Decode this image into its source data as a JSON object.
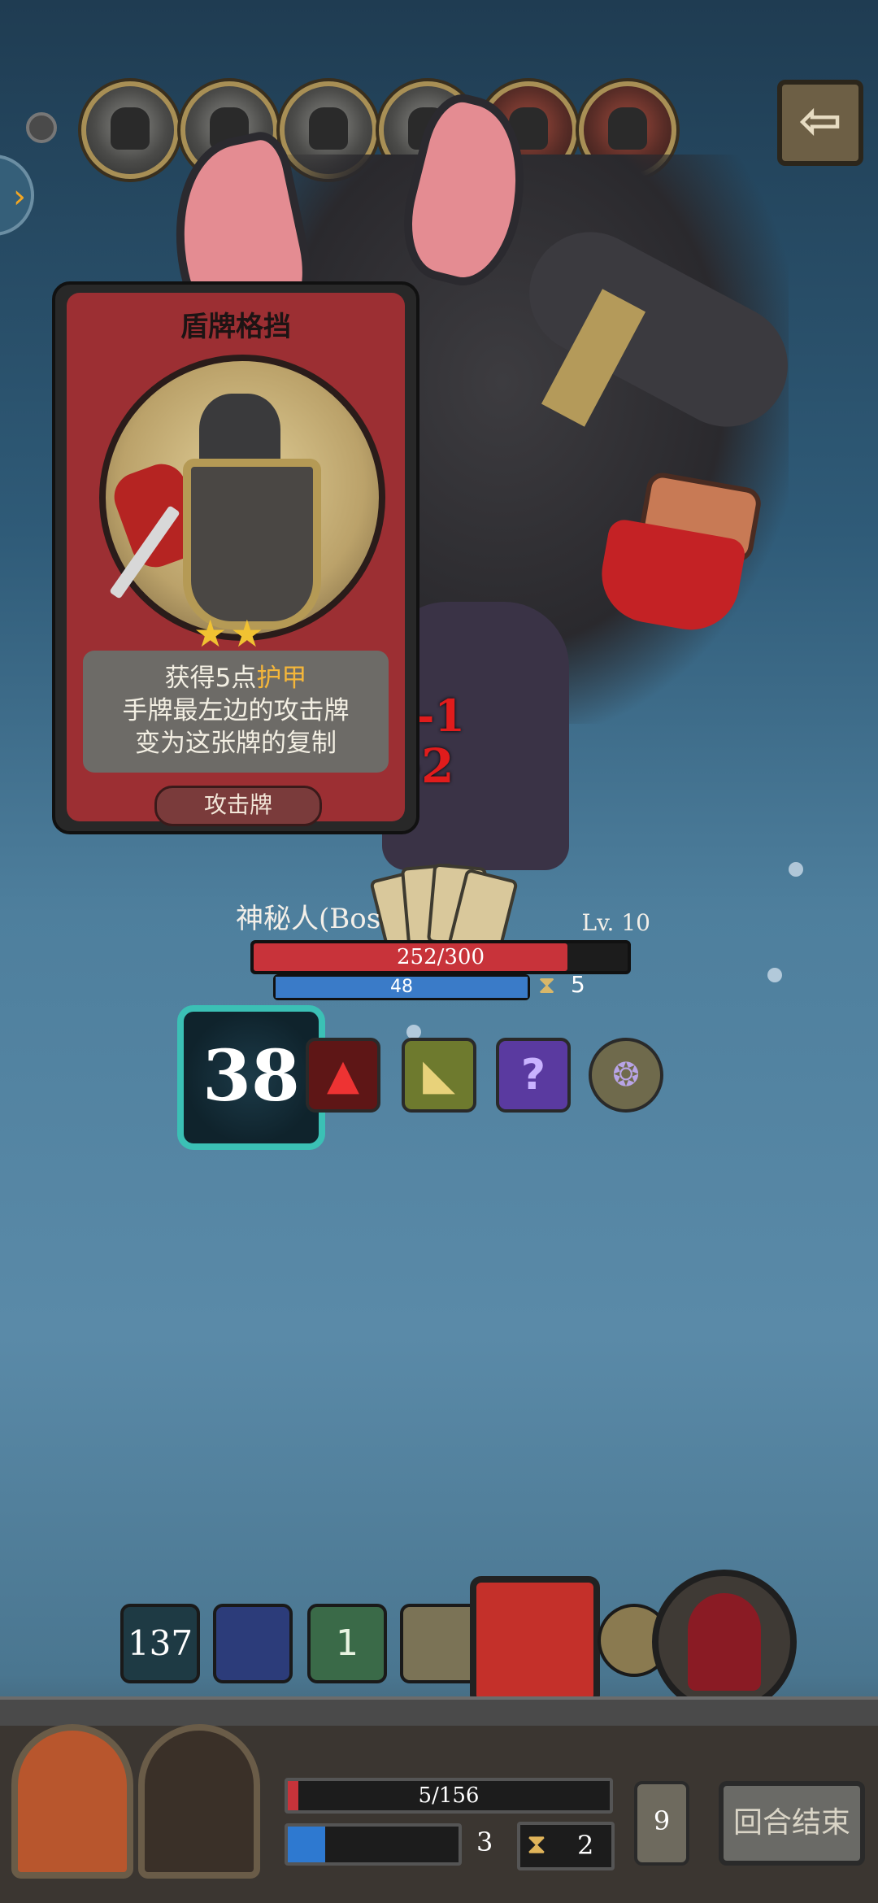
{
  "queue": {
    "count": 6
  },
  "nav": {
    "back_icon": "arrow-left-icon",
    "side_icon": "chevron-right-icon"
  },
  "card": {
    "title": "盾牌格挡",
    "stars": "★★",
    "desc_line1_pre": "获得5点",
    "desc_line1_kw": "护甲",
    "desc_line2": "手牌最左边的攻击牌",
    "desc_line3": "变为这张牌的复制",
    "type": "攻击牌"
  },
  "damage": {
    "d1": "-1",
    "d2": "-2"
  },
  "boss": {
    "name": "神秘人(Bos",
    "level": "Lv. 10",
    "hp_text": "252/300",
    "hp": 252,
    "hp_max": 300,
    "shield_text": "48",
    "hourglass": "5"
  },
  "status": {
    "armor": "38",
    "mystery": "?"
  },
  "turn_order": {
    "first": "137",
    "skull": "1"
  },
  "player": {
    "hp_text": "5/156",
    "hp": 5,
    "hp_max": 156,
    "shield": "3",
    "hourglass": "2",
    "deck": "9",
    "end_turn": "回合结束"
  }
}
